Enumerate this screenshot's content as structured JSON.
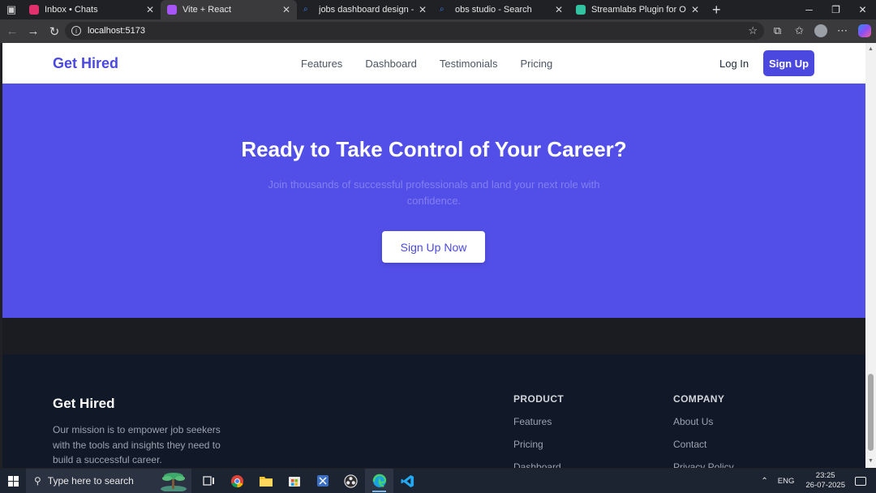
{
  "browser": {
    "tabs": [
      {
        "title": "Inbox • Chats",
        "color": "#e1306c",
        "active": false
      },
      {
        "title": "Vite + React",
        "color": "#a855f7",
        "active": true
      },
      {
        "title": "jobs dashboard design - Search",
        "color": "#3b82f6",
        "active": false
      },
      {
        "title": "obs studio - Search",
        "color": "#3b82f6",
        "active": false
      },
      {
        "title": "Streamlabs Plugin for OBS | Add",
        "color": "#31c3a2",
        "active": false
      }
    ],
    "url": "localhost:5173"
  },
  "site": {
    "logo": "Get Hired",
    "nav": [
      "Features",
      "Dashboard",
      "Testimonials",
      "Pricing"
    ],
    "login": "Log In",
    "signup": "Sign Up",
    "accent": "#4b48df"
  },
  "cta": {
    "title": "Ready to Take Control of Your Career?",
    "subtitle": "Join thousands of successful professionals and land your next role with confidence.",
    "button": "Sign Up Now",
    "background": "#524fe8"
  },
  "footer": {
    "logo": "Get Hired",
    "mission": "Our mission is to empower job seekers with the tools and insights they need to build a successful career.",
    "product": {
      "heading": "PRODUCT",
      "links": [
        "Features",
        "Pricing",
        "Dashboard"
      ]
    },
    "company": {
      "heading": "COMPANY",
      "links": [
        "About Us",
        "Contact",
        "Privacy Policy"
      ]
    }
  },
  "taskbar": {
    "search_placeholder": "Type here to search",
    "language": "ENG",
    "time": "23:25",
    "date": "26-07-2025"
  }
}
